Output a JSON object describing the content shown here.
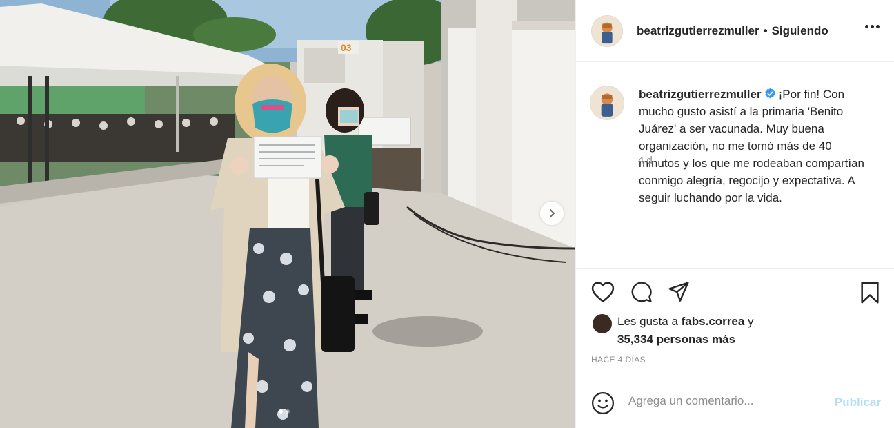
{
  "post": {
    "author": {
      "username": "beatrizgutierrezmuller",
      "follow_separator": "•",
      "follow_status": "Siguiendo"
    },
    "media": {
      "vehicle_number": "03",
      "slide_count": 2,
      "active_slide": 1
    },
    "caption": {
      "username": "beatrizgutierrezmuller",
      "text": "¡Por fin! Con mucho gusto asistí a la primaria 'Benito Juárez' a ser vacunada. Muy buena organización, no me tomó más de 40 minutos y los que me rodeaban compartían conmigo alegría, regocijo y expectativa. A seguir luchando por la vida.",
      "time_ago": "4 d"
    },
    "likes": {
      "prefix": "Les gusta a",
      "first_liker": "fabs.correa",
      "connector": "y",
      "others": "35,334 personas más"
    },
    "timestamp": "HACE 4 DÍAS",
    "comment_box": {
      "placeholder": "Agrega un comentario...",
      "publish_label": "Publicar"
    },
    "icons": {
      "like": "heart-icon",
      "comment": "comment-bubble-icon",
      "share": "paper-plane-icon",
      "save": "bookmark-icon",
      "emoji": "smiley-icon",
      "verified": "verified-badge-icon",
      "more": "more-options-icon",
      "next": "chevron-right-icon"
    },
    "colors": {
      "verified": "#3897f0",
      "publish_disabled": "#b2dffc",
      "muted_text": "#8e8e8e"
    }
  }
}
